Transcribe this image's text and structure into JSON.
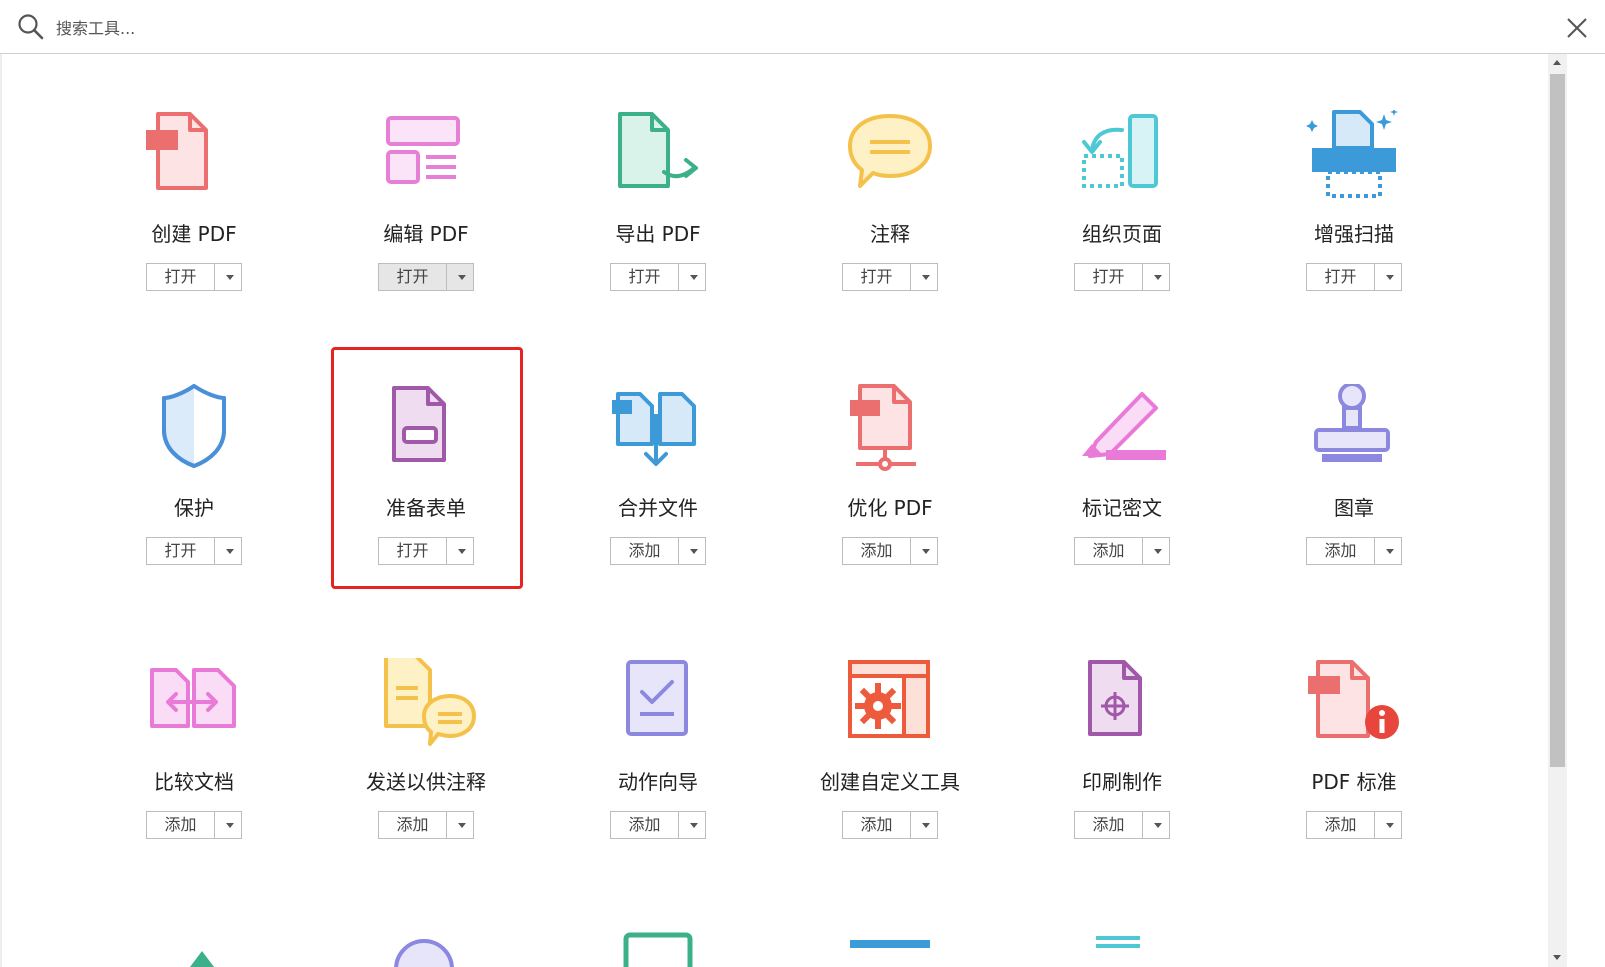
{
  "search": {
    "placeholder": "搜索工具..."
  },
  "tools": [
    {
      "name": "创建 PDF",
      "action": "打开",
      "icon": "create-pdf-icon"
    },
    {
      "name": "编辑 PDF",
      "action": "打开",
      "icon": "edit-pdf-icon"
    },
    {
      "name": "导出 PDF",
      "action": "打开",
      "icon": "export-pdf-icon"
    },
    {
      "name": "注释",
      "action": "打开",
      "icon": "comment-icon"
    },
    {
      "name": "组织页面",
      "action": "打开",
      "icon": "organize-pages-icon"
    },
    {
      "name": "增强扫描",
      "action": "打开",
      "icon": "enhance-scan-icon"
    },
    {
      "name": "保护",
      "action": "打开",
      "icon": "protect-icon"
    },
    {
      "name": "准备表单",
      "action": "打开",
      "icon": "prepare-form-icon"
    },
    {
      "name": "合并文件",
      "action": "添加",
      "icon": "combine-files-icon"
    },
    {
      "name": "优化 PDF",
      "action": "添加",
      "icon": "optimize-pdf-icon"
    },
    {
      "name": "标记密文",
      "action": "添加",
      "icon": "redact-icon"
    },
    {
      "name": "图章",
      "action": "添加",
      "icon": "stamp-icon"
    },
    {
      "name": "比较文档",
      "action": "添加",
      "icon": "compare-files-icon"
    },
    {
      "name": "发送以供注释",
      "action": "添加",
      "icon": "send-for-comments-icon"
    },
    {
      "name": "动作向导",
      "action": "添加",
      "icon": "action-wizard-icon"
    },
    {
      "name": "创建自定义工具",
      "action": "添加",
      "icon": "create-custom-tool-icon"
    },
    {
      "name": "印刷制作",
      "action": "添加",
      "icon": "print-production-icon"
    },
    {
      "name": "PDF 标准",
      "action": "添加",
      "icon": "pdf-standards-icon"
    }
  ],
  "colors": {
    "highlight_border": "#e52421",
    "create_pdf": "#ec6f6f",
    "edit_pdf": "#e580d6",
    "export_pdf": "#3bb08a",
    "comment": "#f4c24a",
    "organize": "#4fc8d6",
    "scan": "#3d9ad9",
    "protect": "#4a90d9",
    "form": "#a058a8",
    "combine": "#3d9ad9",
    "redact": "#ea7ad8",
    "stamp": "#8c88e0",
    "wizard": "#8c88e0",
    "custom": "#ee5a3c"
  }
}
